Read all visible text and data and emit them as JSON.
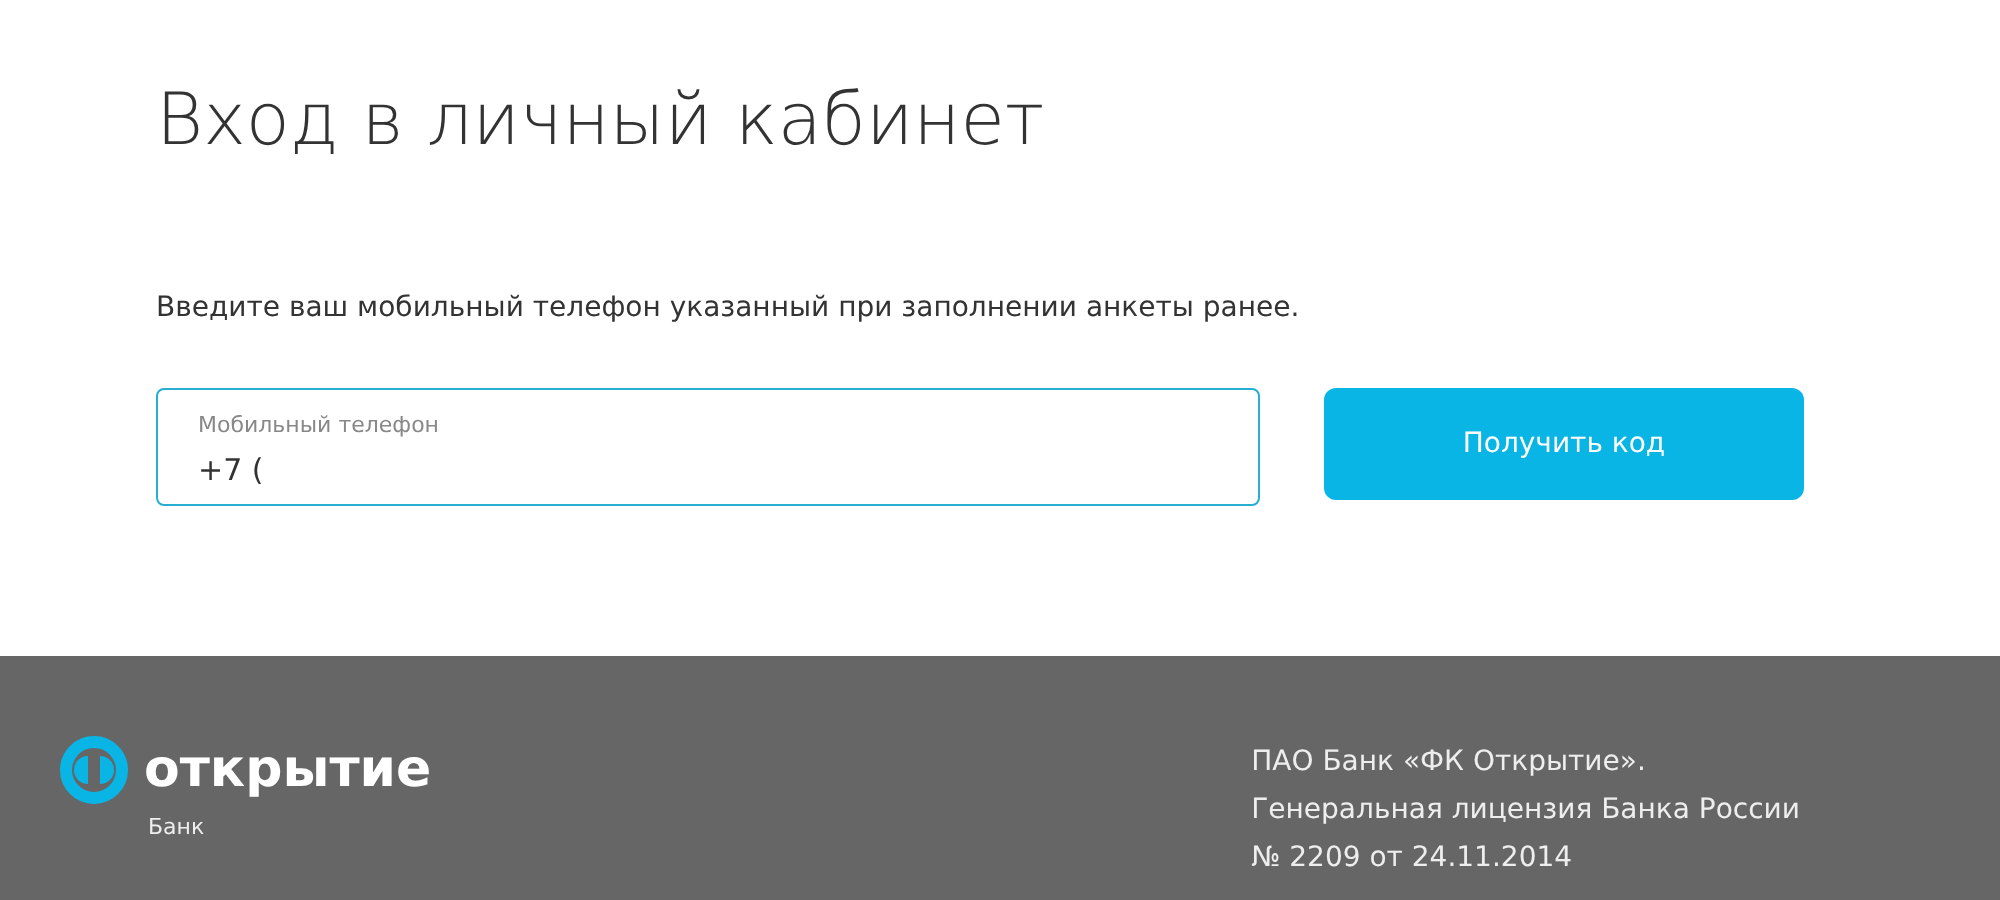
{
  "title": "Вход в личный кабинет",
  "instruction": "Введите ваш мобильный телефон указанный при заполнении анкеты ранее.",
  "phone_field": {
    "label": "Мобильный телефон",
    "value": "+7 ("
  },
  "submit_button": "Получить код",
  "footer": {
    "logo": {
      "name": "открытие",
      "subtitle": "Банк"
    },
    "legal_lines": [
      "ПАО Банк «ФК Открытие».",
      "Генеральная лицензия Банка России",
      "№ 2209 от 24.11.2014"
    ]
  }
}
